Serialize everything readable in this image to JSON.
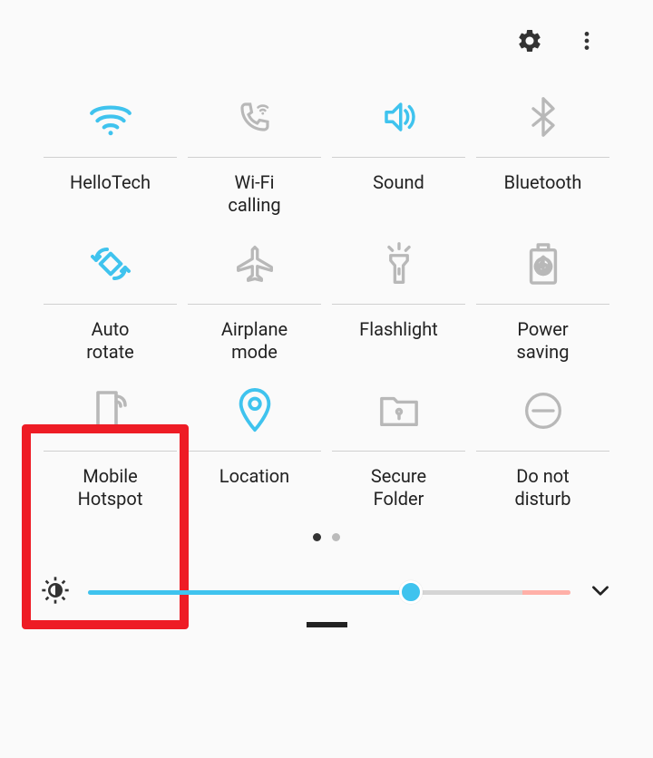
{
  "colors": {
    "active": "#3fc3ee",
    "inactive": "#b8b8b8",
    "highlight": "#ee1c25",
    "text": "#222222"
  },
  "header": {
    "settings": "Settings",
    "more": "More options"
  },
  "tiles": [
    {
      "label": "HelloTech",
      "icon": "wifi-icon",
      "active": true
    },
    {
      "label": "Wi-Fi\ncalling",
      "icon": "wifi-calling-icon",
      "active": false
    },
    {
      "label": "Sound",
      "icon": "sound-icon",
      "active": true
    },
    {
      "label": "Bluetooth",
      "icon": "bluetooth-icon",
      "active": false
    },
    {
      "label": "Auto\nrotate",
      "icon": "auto-rotate-icon",
      "active": true
    },
    {
      "label": "Airplane\nmode",
      "icon": "airplane-icon",
      "active": false
    },
    {
      "label": "Flashlight",
      "icon": "flashlight-icon",
      "active": false
    },
    {
      "label": "Power\nsaving",
      "icon": "power-saving-icon",
      "active": false
    },
    {
      "label": "Mobile\nHotspot",
      "icon": "hotspot-icon",
      "active": false,
      "highlighted": true
    },
    {
      "label": "Location",
      "icon": "location-icon",
      "active": true
    },
    {
      "label": "Secure\nFolder",
      "icon": "secure-folder-icon",
      "active": false
    },
    {
      "label": "Do not\ndisturb",
      "icon": "dnd-icon",
      "active": false
    }
  ],
  "pagination": {
    "current": 1,
    "total": 2
  },
  "brightness": {
    "value": 67,
    "max": 100
  }
}
